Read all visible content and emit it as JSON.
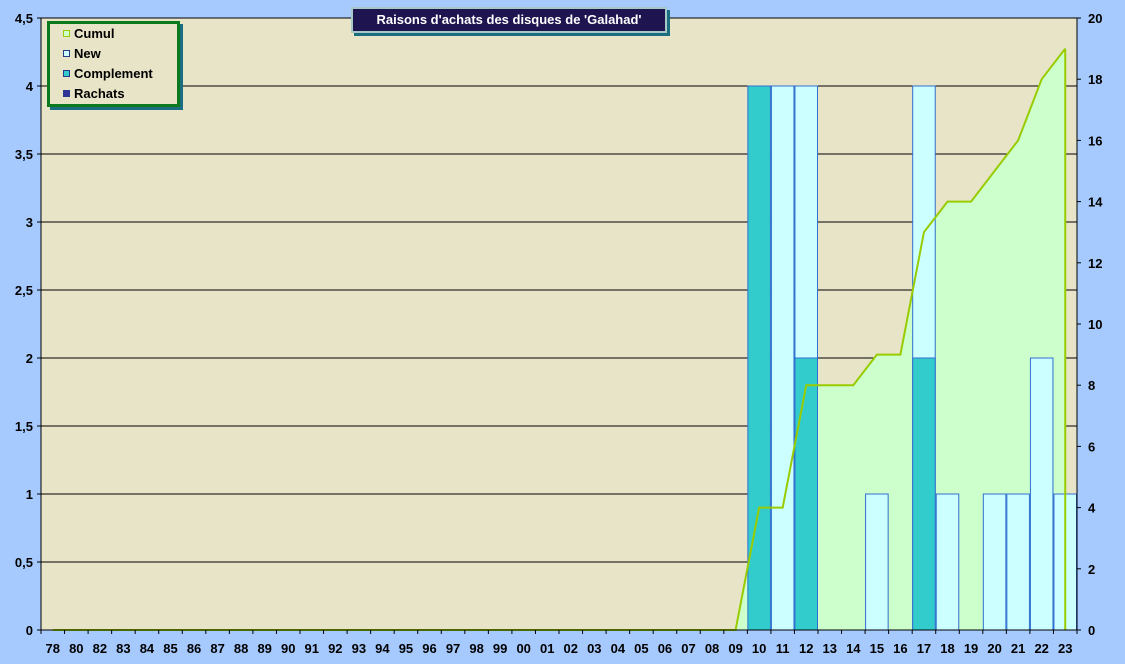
{
  "chart_data": {
    "type": "bar",
    "title": "Raisons d'achats des disques de 'Galahad'",
    "categories": [
      "78",
      "80",
      "82",
      "83",
      "84",
      "85",
      "86",
      "87",
      "88",
      "89",
      "90",
      "91",
      "92",
      "93",
      "94",
      "95",
      "96",
      "97",
      "98",
      "99",
      "00",
      "01",
      "02",
      "03",
      "04",
      "05",
      "06",
      "07",
      "08",
      "09",
      "10",
      "11",
      "12",
      "13",
      "14",
      "15",
      "16",
      "17",
      "18",
      "19",
      "20",
      "21",
      "22",
      "23"
    ],
    "series": [
      {
        "name": "Cumul",
        "axis": "right",
        "render": "area-line",
        "values": [
          0,
          0,
          0,
          0,
          0,
          0,
          0,
          0,
          0,
          0,
          0,
          0,
          0,
          0,
          0,
          0,
          0,
          0,
          0,
          0,
          0,
          0,
          0,
          0,
          0,
          0,
          0,
          0,
          0,
          0,
          4,
          4,
          8,
          8,
          8,
          9,
          9,
          13,
          14,
          14,
          15,
          16,
          18,
          19
        ]
      },
      {
        "name": "New",
        "axis": "left",
        "render": "bar",
        "values": [
          0,
          0,
          0,
          0,
          0,
          0,
          0,
          0,
          0,
          0,
          0,
          0,
          0,
          0,
          0,
          0,
          0,
          0,
          0,
          0,
          0,
          0,
          0,
          0,
          0,
          0,
          0,
          0,
          0,
          0,
          0,
          4,
          4,
          0,
          0,
          1,
          0,
          4,
          1,
          0,
          1,
          1,
          2,
          1
        ]
      },
      {
        "name": "Complement",
        "axis": "left",
        "render": "bar",
        "values": [
          0,
          0,
          0,
          0,
          0,
          0,
          0,
          0,
          0,
          0,
          0,
          0,
          0,
          0,
          0,
          0,
          0,
          0,
          0,
          0,
          0,
          0,
          0,
          0,
          0,
          0,
          0,
          0,
          0,
          0,
          4,
          0,
          2,
          0,
          0,
          0,
          0,
          2,
          0,
          0,
          0,
          0,
          0,
          0
        ]
      },
      {
        "name": "Rachats",
        "axis": "left",
        "render": "bar",
        "values": [
          0,
          0,
          0,
          0,
          0,
          0,
          0,
          0,
          0,
          0,
          0,
          0,
          0,
          0,
          0,
          0,
          0,
          0,
          0,
          0,
          0,
          0,
          0,
          0,
          0,
          0,
          0,
          0,
          0,
          0,
          0,
          0,
          0,
          0,
          0,
          0,
          0,
          0,
          0,
          0,
          0,
          0,
          0,
          0
        ]
      }
    ],
    "ylim_left": [
      0,
      4.5
    ],
    "yticks_left": [
      "0",
      "0,5",
      "1",
      "1,5",
      "2",
      "2,5",
      "3",
      "3,5",
      "4",
      "4,5"
    ],
    "ylim_right": [
      0,
      20
    ],
    "yticks_right": [
      "0",
      "2",
      "4",
      "6",
      "8",
      "10",
      "12",
      "14",
      "16",
      "18",
      "20"
    ],
    "grid": true,
    "legend_position": "top-left",
    "colors": {
      "background": "#a6cafe",
      "plot": "#e8e4c8",
      "cumul_line": "#99cc00",
      "cumul_fill": "#ccffcc",
      "new": "#ccffff",
      "complement": "#33cccc",
      "rachats": "#333399",
      "bar_border": "#2f6fd0",
      "grid": "#000000"
    }
  }
}
